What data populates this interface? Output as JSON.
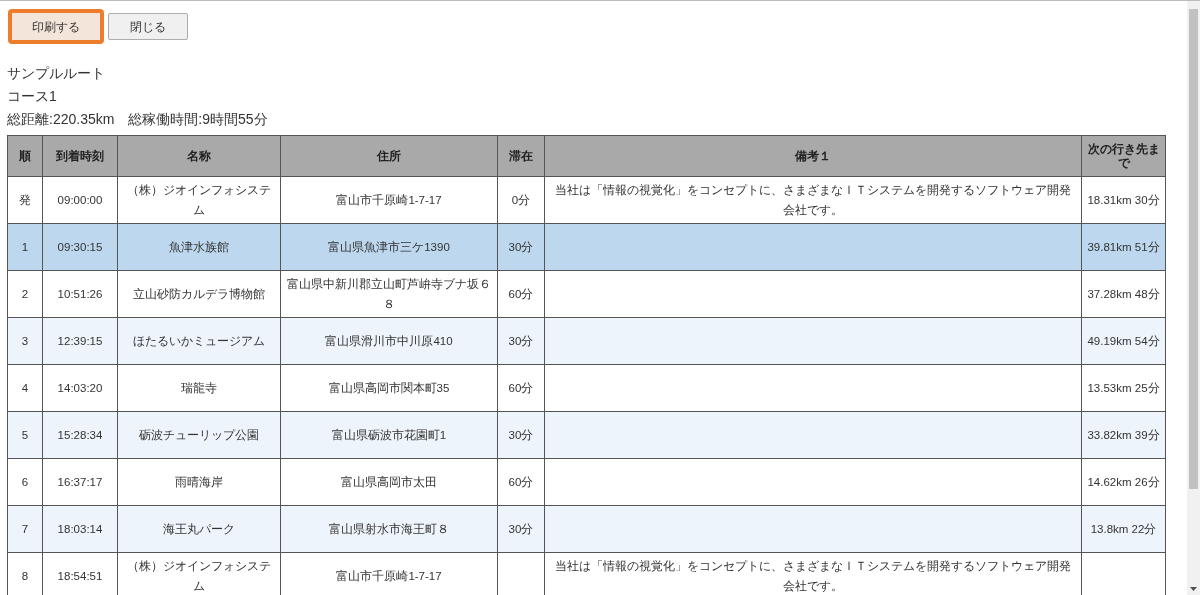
{
  "buttons": [
    {
      "label": "印刷する",
      "focused": true
    },
    {
      "label": "閉じる",
      "focused": false
    }
  ],
  "route_name": "サンプルルート",
  "course": "コース1",
  "summary": "総距離:220.35km　総稼働時間:9時間55分",
  "table": {
    "columns": [
      "順",
      "到着時刻",
      "名称",
      "住所",
      "滞在",
      "備考１",
      "次の行き先まで"
    ],
    "rows": [
      {
        "selected": false,
        "cells": [
          "発",
          "09:00:00",
          "（株）ジオインフォシステム",
          "富山市千原崎1-7-17",
          "0分",
          "当社は「情報の視覚化」をコンセプトに、さまざまなＩＴシステムを開発するソフトウェア開発会社です。",
          "18.31km 30分"
        ]
      },
      {
        "selected": true,
        "cells": [
          "1",
          "09:30:15",
          "魚津水族館",
          "富山県魚津市三ケ1390",
          "30分",
          "",
          "39.81km 51分"
        ]
      },
      {
        "selected": false,
        "cells": [
          "2",
          "10:51:26",
          "立山砂防カルデラ博物館",
          "富山県中新川郡立山町芦峅寺ブナ坂６８",
          "60分",
          "",
          "37.28km 48分"
        ]
      },
      {
        "selected": false,
        "cells": [
          "3",
          "12:39:15",
          "ほたるいかミュージアム",
          "富山県滑川市中川原410",
          "30分",
          "",
          "49.19km 54分"
        ]
      },
      {
        "selected": false,
        "cells": [
          "4",
          "14:03:20",
          "瑞龍寺",
          "富山県高岡市関本町35",
          "60分",
          "",
          "13.53km 25分"
        ]
      },
      {
        "selected": false,
        "cells": [
          "5",
          "15:28:34",
          "砺波チューリップ公園",
          "富山県砺波市花園町1",
          "30分",
          "",
          "33.82km 39分"
        ]
      },
      {
        "selected": false,
        "cells": [
          "6",
          "16:37:17",
          "雨晴海岸",
          "富山県高岡市太田",
          "60分",
          "",
          "14.62km 26分"
        ]
      },
      {
        "selected": false,
        "cells": [
          "7",
          "18:03:14",
          "海王丸パーク",
          "富山県射水市海王町８",
          "30分",
          "",
          "13.8km 22分"
        ]
      },
      {
        "selected": false,
        "cells": [
          "8",
          "18:54:51",
          "（株）ジオインフォシステム",
          "富山市千原崎1-7-17",
          "",
          "当社は「情報の視覚化」をコンセプトに、さまざまなＩＴシステムを開発するソフトウェア開発会社です。",
          ""
        ]
      }
    ]
  }
}
